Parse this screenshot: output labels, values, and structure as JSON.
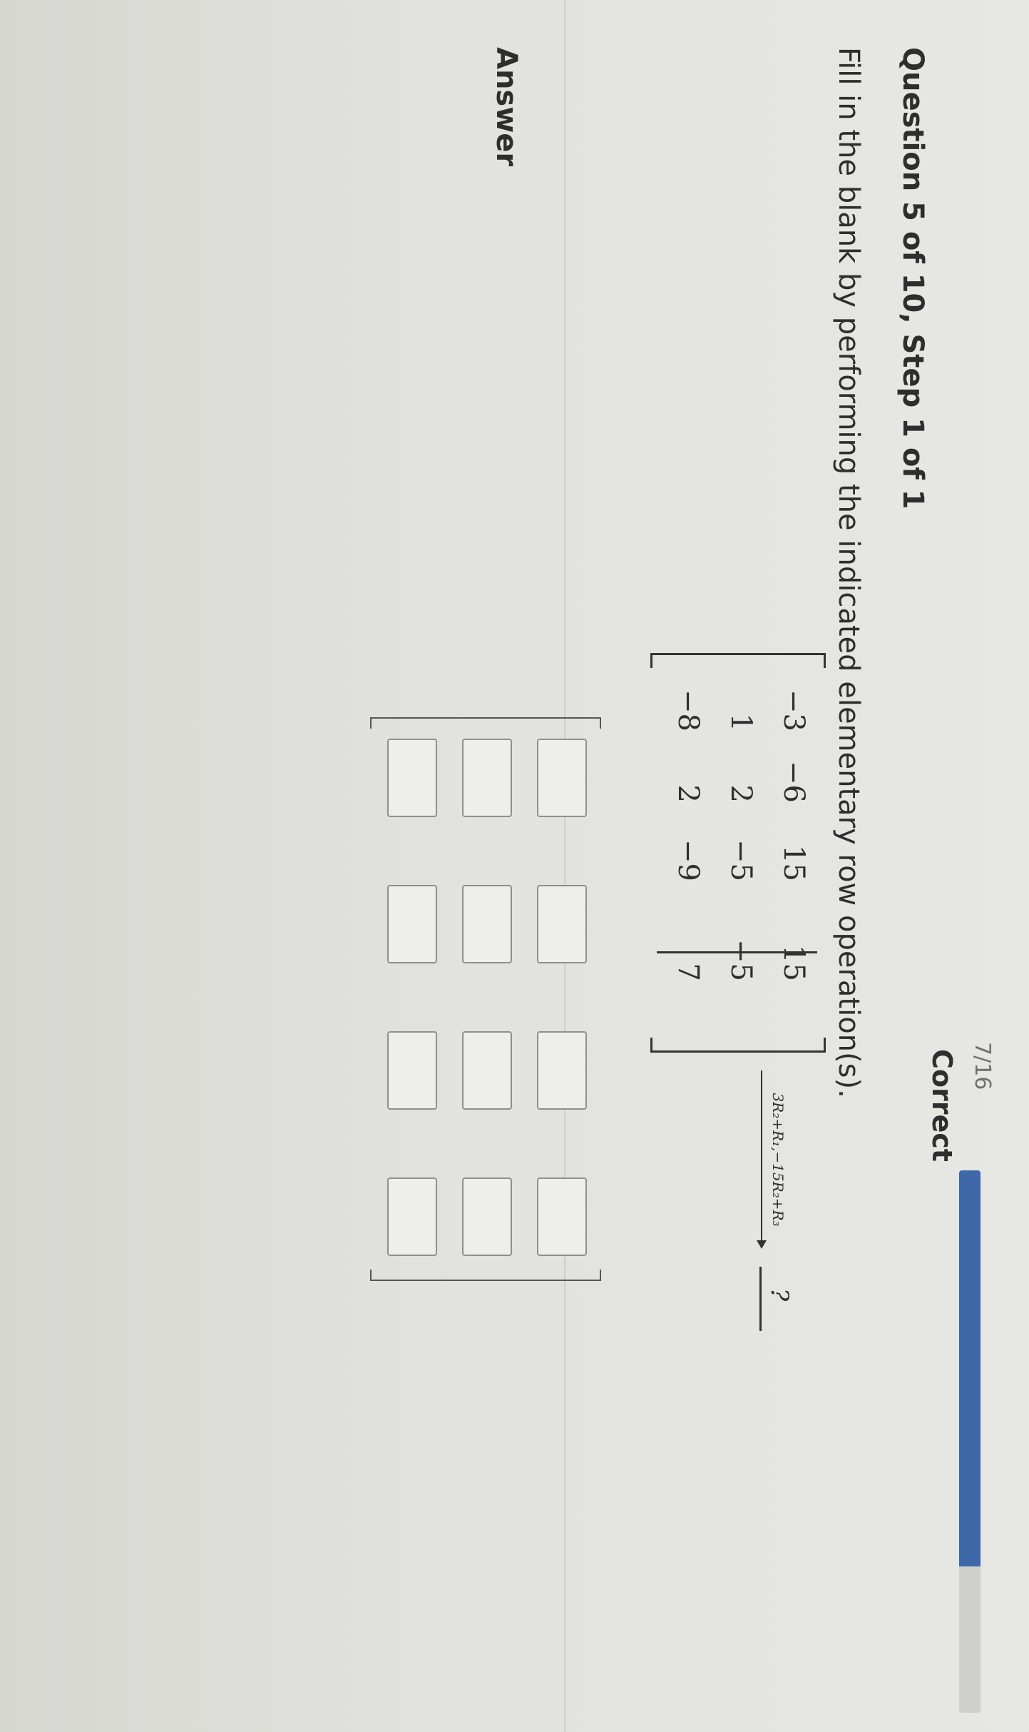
{
  "header": {
    "question_title": "Question 5 of 10, Step 1 of 1",
    "progress_text": "7/16",
    "status": "Correct",
    "progress_fraction": 0.73
  },
  "prompt": "Fill in the blank by performing the indicated elementary row operation(s).",
  "matrix": {
    "rows": [
      [
        "−3",
        "−6",
        "15",
        "15"
      ],
      [
        "1",
        "2",
        "−5",
        "−5"
      ],
      [
        "−8",
        "2",
        "−9",
        "7"
      ]
    ]
  },
  "operation": "3R₂+R₁,−15R₂+R₃",
  "blank_text": "?",
  "answer": {
    "label": "Answer",
    "cells": [
      [
        "",
        "",
        "",
        ""
      ],
      [
        "",
        "",
        "",
        ""
      ],
      [
        "",
        "",
        "",
        ""
      ]
    ]
  },
  "colors": {
    "progress_fill": "#3f68a8",
    "track": "#cfcfcb"
  }
}
